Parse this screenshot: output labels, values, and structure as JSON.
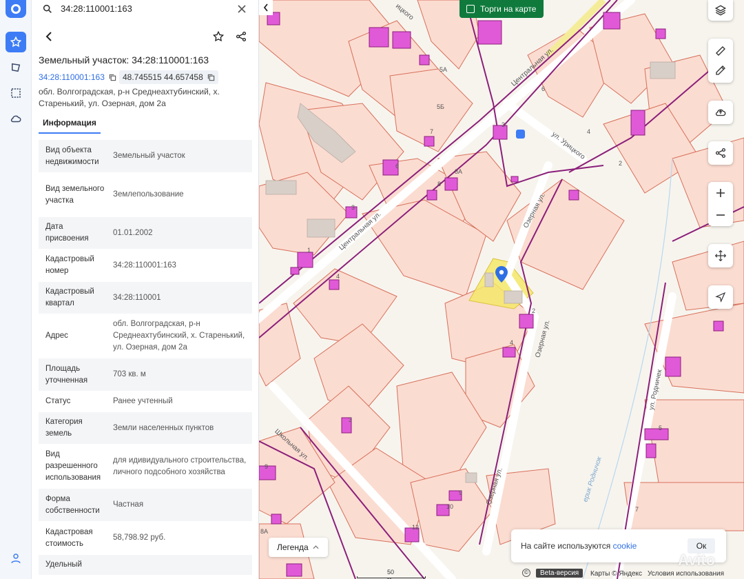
{
  "search": {
    "value": "34:28:110001:163"
  },
  "panel": {
    "title": "Земельный участок: 34:28:110001:163",
    "cadastral_link": "34:28:110001:163",
    "coords": "48.745515 44.657458",
    "address": "обл. Волгоградская, р-н Среднеахтубинский, х. Старенький, ул. Озерная, дом 2а",
    "tab": "Информация",
    "props": [
      {
        "k": "Вид объекта недвижимости",
        "v": "Земельный участок"
      },
      {
        "k": "Вид земельного участка",
        "v": "Землепользование"
      },
      {
        "k": "Дата присвоения",
        "v": "01.01.2002"
      },
      {
        "k": "Кадастровый номер",
        "v": "34:28:110001:163"
      },
      {
        "k": "Кадастровый квартал",
        "v": "34:28:110001"
      },
      {
        "k": "Адрес",
        "v": "обл. Волгоградская, р-н Среднеахтубинский, х. Старенький, ул. Озерная, дом 2а"
      },
      {
        "k": "Площадь уточненная",
        "v": "703 кв. м"
      },
      {
        "k": "Статус",
        "v": "Ранее учтенный"
      },
      {
        "k": "Категория земель",
        "v": "Земли населенных пунктов"
      },
      {
        "k": "Вид разрешенного использования",
        "v": "для идивидуального строительства, личного подсобного хозяйства"
      },
      {
        "k": "Форма собственности",
        "v": "Частная"
      },
      {
        "k": "Кадастровая стоимость",
        "v": "58,798.92 руб."
      },
      {
        "k": "Удельный",
        "v": ""
      }
    ]
  },
  "map": {
    "auction_label": "Торги на карте",
    "legend_label": "Легенда",
    "cookie_text": "На сайте используются",
    "cookie_link": "cookie",
    "cookie_ok": "Ок",
    "scale_label": "50 м",
    "beta_label": "Beta-версия",
    "attribution": "Карты © Яндекс",
    "terms": "Условия использования",
    "watermark": "Avito",
    "streets": {
      "central_top": "Центральная ул.",
      "central_mid": "Центральная ул.",
      "uritskogo_top": "ицкого",
      "uritskogo": "ул. Урицкого",
      "ozernaya_1": "Озерная ул.",
      "ozernaya_2": "Озерная ул.",
      "ozernaya_3": "Озерная ул.",
      "rodnichek": "ул. Родничек",
      "shkolnaya": "Школьная ул.",
      "ravine": "ерик Родничок"
    },
    "house_numbers": [
      "6",
      "5А",
      "5Б",
      "7",
      "4",
      "2",
      "6",
      "8А",
      "8",
      "3",
      "1",
      "4",
      "2",
      "4",
      "3",
      "9",
      "10",
      "12",
      "5",
      "7",
      "9",
      "8А",
      "3"
    ]
  },
  "colors": {
    "accent": "#3d7cf5",
    "parcel_fill": "#fbdcd1",
    "parcel_border": "#d7705a",
    "boundary": "#8b1f7a",
    "building": "#e05ad8",
    "selected": "#f5e86a",
    "auction": "#0f7a3c"
  }
}
